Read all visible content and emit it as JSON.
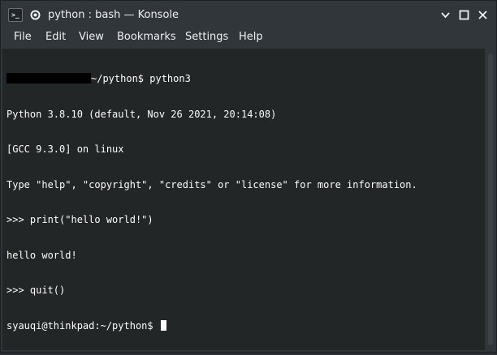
{
  "window": {
    "title": "python : bash — Konsole",
    "app_icon_glyph": ">_",
    "icons": {
      "app": "terminal-icon",
      "pin": "gear-pin-icon",
      "minimize": "chevron-down-icon",
      "maximize": "square-icon",
      "close": "close-icon"
    }
  },
  "menu": {
    "items": [
      "File",
      "Edit",
      "View",
      "Bookmarks",
      "Settings",
      "Help"
    ]
  },
  "terminal": {
    "lines": [
      {
        "prefix_redacted": true,
        "text": "~/python$ python3"
      },
      {
        "text": "Python 3.8.10 (default, Nov 26 2021, 20:14:08)"
      },
      {
        "text": "[GCC 9.3.0] on linux"
      },
      {
        "text": "Type \"help\", \"copyright\", \"credits\" or \"license\" for more information."
      },
      {
        "text": ">>> print(\"hello world!\")"
      },
      {
        "text": "hello world!"
      },
      {
        "text": ">>> quit()"
      },
      {
        "text": "syauqi@thinkpad:~/python$ ",
        "cursor": true
      }
    ]
  },
  "colors": {
    "window_bg": "#31363b",
    "terminal_bg": "#232627",
    "terminal_fg": "#fcfcfc"
  }
}
